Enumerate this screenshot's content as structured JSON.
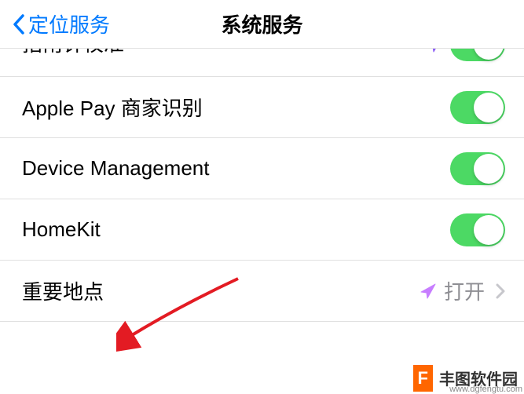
{
  "header": {
    "back_label": "定位服务",
    "title": "系统服务"
  },
  "items": [
    {
      "label": "指南针校准",
      "type": "nav-toggle"
    },
    {
      "label": "Apple Pay 商家识别",
      "type": "toggle",
      "on": true
    },
    {
      "label": "Device Management",
      "type": "toggle",
      "on": true
    },
    {
      "label": "HomeKit",
      "type": "toggle",
      "on": true
    },
    {
      "label": "重要地点",
      "type": "link",
      "status": "打开"
    }
  ],
  "watermark": {
    "logo_letter": "F",
    "text": "丰图软件园",
    "url": "www.dgfengtu.com"
  }
}
